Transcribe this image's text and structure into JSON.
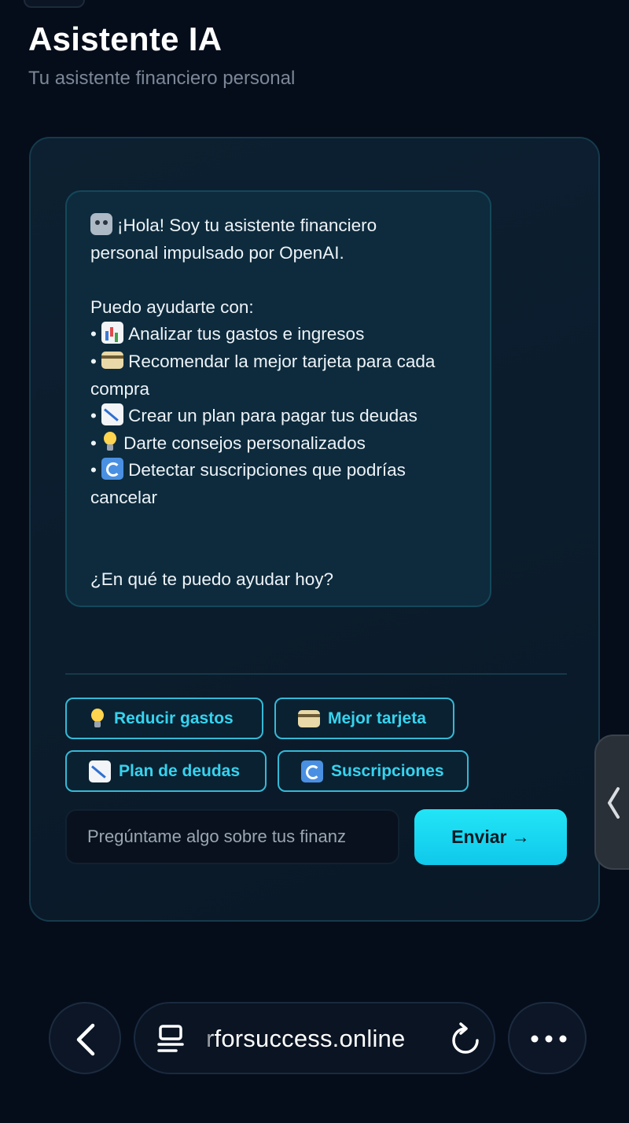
{
  "header": {
    "title": "Asistente IA",
    "subtitle": "Tu asistente financiero personal"
  },
  "chat": {
    "greeting_line1": "¡Hola! Soy tu asistente financiero",
    "greeting_line2": "personal impulsado por OpenAI.",
    "intro": "Puedo ayudarte con:",
    "items": [
      {
        "icon": "bar-chart-icon",
        "text": "Analizar tus gastos e ingresos"
      },
      {
        "icon": "credit-card-icon",
        "text_line1": "Recomendar la mejor tarjeta para cada",
        "text_line2": "compra"
      },
      {
        "icon": "chart-decreasing-icon",
        "text": "Crear un plan para pagar tus deudas"
      },
      {
        "icon": "light-bulb-icon",
        "text": "Darte consejos personalizados"
      },
      {
        "icon": "cycle-arrows-icon",
        "text_line1": "Detectar suscripciones que podrías",
        "text_line2": "cancelar"
      }
    ],
    "bullet": "•",
    "closing": "¿En qué te puedo ayudar hoy?"
  },
  "quick_actions": [
    {
      "icon": "light-bulb-icon",
      "label": "Reducir gastos"
    },
    {
      "icon": "credit-card-icon",
      "label": "Mejor tarjeta"
    },
    {
      "icon": "chart-decreasing-icon",
      "label": "Plan de deudas"
    },
    {
      "icon": "cycle-arrows-icon",
      "label": "Suscripciones"
    }
  ],
  "composer": {
    "placeholder_visible": "Pregúntame algo sobre tus finanz",
    "send_label": "Enviar →"
  },
  "browser": {
    "url": "rforsuccess.online"
  },
  "colors": {
    "background": "#050d1a",
    "accent": "#22e5f6",
    "chip_text": "#36d3ef"
  }
}
